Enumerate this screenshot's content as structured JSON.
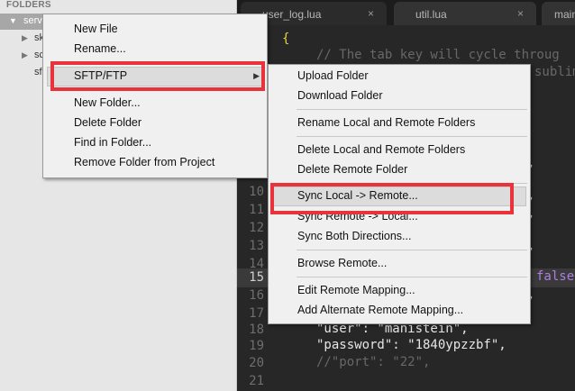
{
  "sidebar": {
    "header": "FOLDERS",
    "tree": [
      {
        "label": "serv",
        "expanded": true
      },
      {
        "label": "sk",
        "expanded": false
      },
      {
        "label": "sc",
        "expanded": false
      },
      {
        "label": "sf",
        "expanded": null
      }
    ]
  },
  "tabs": [
    {
      "label": "user_log.lua",
      "close": "×"
    },
    {
      "label": "util.lua",
      "close": "×"
    },
    {
      "label": "main"
    }
  ],
  "editor": {
    "lines": [
      {
        "num": "",
        "text": "{"
      },
      {
        "num": "",
        "text": "// The tab key will cycle throug"
      },
      {
        "num": "",
        "text": "subliml"
      },
      {
        "num": "",
        "text": ","
      },
      {
        "num": "",
        "text": ","
      },
      {
        "num": "",
        "text": ","
      },
      {
        "num": "",
        "text": ","
      },
      {
        "num": "",
        "text": "false"
      },
      {
        "num": "",
        "text": ","
      },
      {
        "num": "18",
        "text": "\"user\": \"manistein\","
      },
      {
        "num": "19",
        "text": "\"password\": \"1840ypzzbf\","
      },
      {
        "num": "20",
        "text": "//\"port\": \"22\","
      },
      {
        "num": "21",
        "text": ""
      }
    ],
    "gutter": [
      "10",
      "11",
      "12",
      "13",
      "14",
      "15",
      "16",
      "17",
      "18",
      "19",
      "20",
      "21"
    ]
  },
  "context_menu": {
    "items": [
      {
        "label": "New File"
      },
      {
        "label": "Rename..."
      },
      {
        "label": "SFTP/FTP",
        "submenu": true
      },
      {
        "label": "New Folder..."
      },
      {
        "label": "Delete Folder"
      },
      {
        "label": "Find in Folder..."
      },
      {
        "label": "Remove Folder from Project"
      }
    ]
  },
  "submenu": {
    "items": [
      {
        "label": "Upload Folder"
      },
      {
        "label": "Download Folder"
      },
      {
        "label": "Rename Local and Remote Folders"
      },
      {
        "label": "Delete Local and Remote Folders"
      },
      {
        "label": "Delete Remote Folder"
      },
      {
        "label": "Sync Local -> Remote..."
      },
      {
        "label": "Sync Remote -> Local..."
      },
      {
        "label": "Sync Both Directions..."
      },
      {
        "label": "Browse Remote..."
      },
      {
        "label": "Edit Remote Mapping..."
      },
      {
        "label": "Add Alternate Remote Mapping..."
      }
    ]
  },
  "colors": {
    "highlight_box": "#e8333d",
    "comment": "#686868",
    "string": "#e6e6e6",
    "keyword_false": "#ad7fe0"
  },
  "icons": {
    "expanded": "triangle-down-icon",
    "collapsed": "triangle-right-icon",
    "submenu": "submenu-arrow-icon",
    "close": "close-icon"
  }
}
